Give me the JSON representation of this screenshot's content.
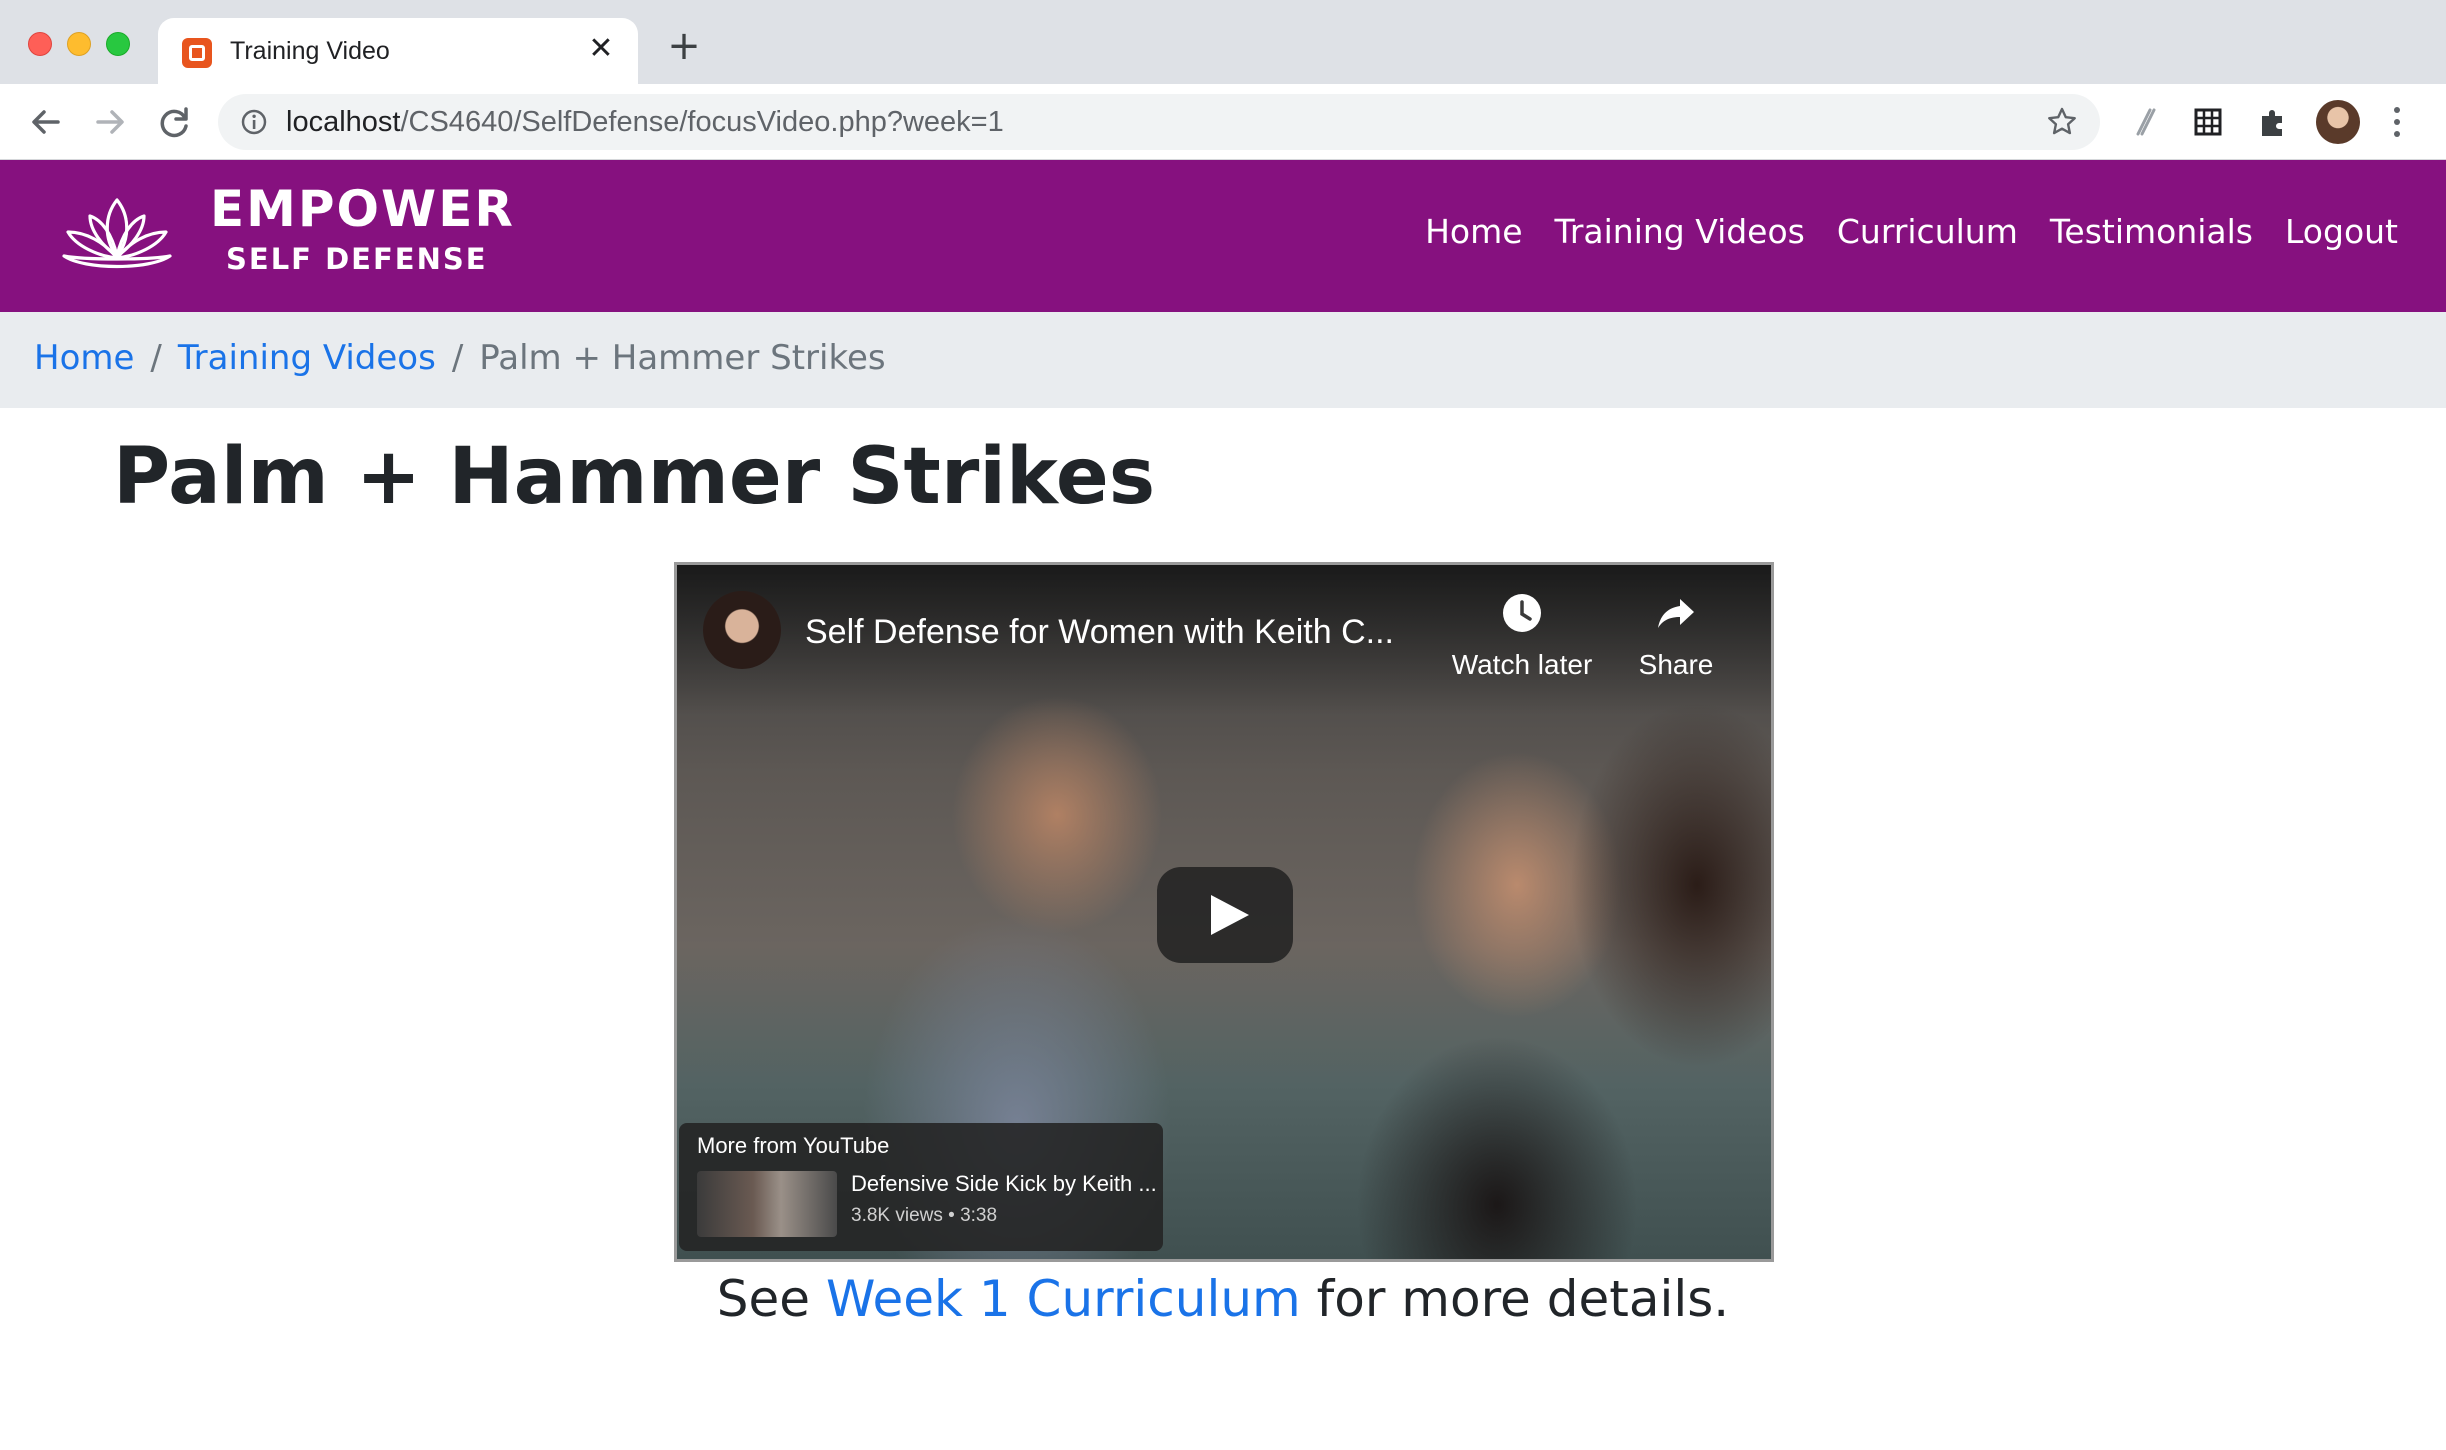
{
  "browser": {
    "tab_title": "Training Video",
    "url_host": "localhost",
    "url_path": "/CS4640/SelfDefense/focusVideo.php?week=1",
    "icons": [
      "back-icon",
      "forward-icon",
      "reload-icon",
      "info-icon",
      "star-icon",
      "extension-icon",
      "grid-icon",
      "puzzle-icon",
      "profile-avatar",
      "menu-icon"
    ]
  },
  "site": {
    "brand_line1": "EMPOWER",
    "brand_line2": "SELF DEFENSE",
    "nav": [
      "Home",
      "Training Videos",
      "Curriculum",
      "Testimonials",
      "Logout"
    ],
    "header_color": "#86117f"
  },
  "breadcrumb": {
    "items": [
      "Home",
      "Training Videos"
    ],
    "separator": "/",
    "current": "Palm + Hammer Strikes"
  },
  "page": {
    "title": "Palm + Hammer Strikes"
  },
  "video": {
    "title": "Self Defense for Women with Keith C...",
    "watch_later": "Watch later",
    "share": "Share",
    "more_from": "More from YouTube",
    "suggested_title": "Defensive Side Kick by Keith ...",
    "suggested_meta": "3.8K views • 3:38"
  },
  "caption": {
    "prefix": "See",
    "link": "Week 1 Curriculum",
    "suffix": "for more details."
  },
  "colors": {
    "link": "#1a73e8",
    "brand_purple": "#86117f"
  }
}
